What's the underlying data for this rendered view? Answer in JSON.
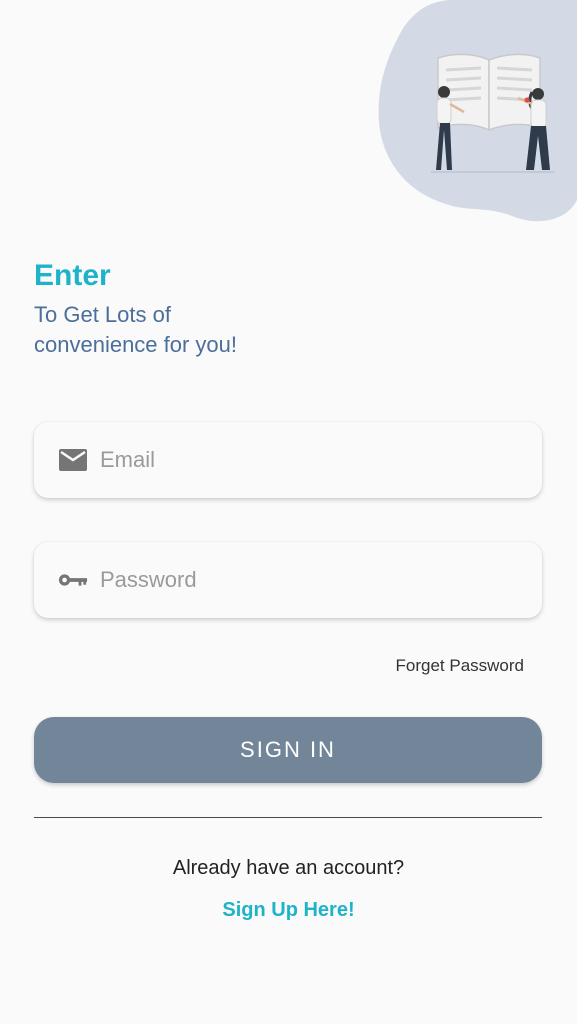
{
  "heading": {
    "title": "Enter",
    "subtitle_line1": "To Get Lots of",
    "subtitle_line2": "convenience for you!"
  },
  "form": {
    "email": {
      "placeholder": "Email",
      "value": "",
      "icon": "mail-icon"
    },
    "password": {
      "placeholder": "Password",
      "value": "",
      "icon": "key-icon"
    },
    "forget_label": "Forget Password",
    "signin_label": "SIGN IN"
  },
  "footer": {
    "already_text": "Already have an account?",
    "signup_label": "Sign Up Here!"
  },
  "colors": {
    "accent": "#1eb3c8",
    "subtitle": "#4b6f9a",
    "button": "#738699",
    "blob": "#d3dae5",
    "background": "#fafafa"
  }
}
